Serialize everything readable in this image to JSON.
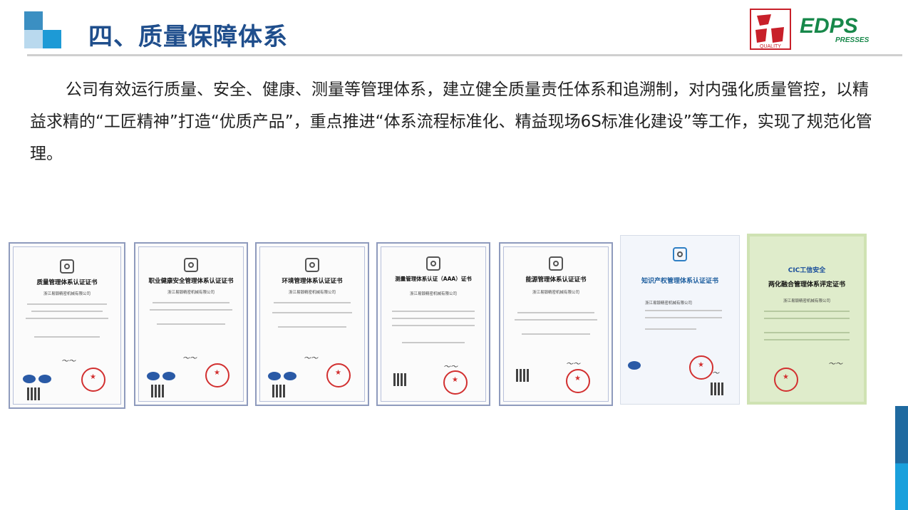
{
  "header": {
    "title": "四、质量保障体系",
    "logos": [
      {
        "name": "quality-logo",
        "icon": "quality-seal-icon",
        "text": "QUALITY"
      },
      {
        "name": "edps-logo",
        "text": "EDPS",
        "subtext": "PRESSES"
      }
    ]
  },
  "body": {
    "paragraph": "公司有效运行质量、安全、健康、测量等管理体系，建立健全质量责任体系和追溯制，对内强化质量管控，以精益求精的“工匠精神”打造“优质产品”，重点推进“体系流程标准化、精益现场6S标准化建设”等工作，实现了规范化管理。"
  },
  "certificates": [
    {
      "title": "质量管理体系认证证书",
      "company": "浙江易锻精密机械有限公司"
    },
    {
      "title": "职业健康安全管理体系认证证书",
      "company": "浙江易锻精密机械有限公司"
    },
    {
      "title": "环境管理体系认证证书",
      "company": "浙江易锻精密机械有限公司"
    },
    {
      "title": "测量管理体系认证（AAA）证书",
      "company": "浙江易锻精密机械有限公司"
    },
    {
      "title": "能源管理体系认证证书",
      "company": "浙江易锻精密机械有限公司"
    },
    {
      "title": "知识产权管理体系认证证书",
      "company": "浙江易锻精密机械有限公司"
    },
    {
      "title": "两化融合管理体系评定证书",
      "company": "浙江易锻精密机械有限公司",
      "brand": "CIC工信安全"
    }
  ],
  "colors": {
    "title": "#1f4e8c",
    "accent": "#1d9ad6",
    "seal": "#d23030"
  }
}
